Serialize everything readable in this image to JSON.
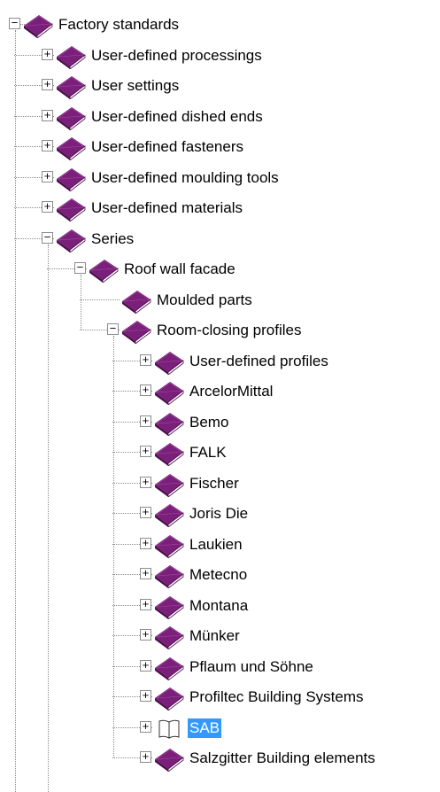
{
  "tree": {
    "selected_label": "SAB",
    "colors": {
      "book": "#7a1f7a",
      "book_dark": "#4a0f4a",
      "selection": "#3399ff"
    },
    "nodes": [
      {
        "label": "Factory standards",
        "level": 0,
        "expander": "−",
        "icon": "book-icon"
      },
      {
        "label": "User-defined processings",
        "level": 1,
        "expander": "+",
        "icon": "book-icon"
      },
      {
        "label": "User settings",
        "level": 1,
        "expander": "+",
        "icon": "book-icon"
      },
      {
        "label": "User-defined dished ends",
        "level": 1,
        "expander": "+",
        "icon": "book-icon"
      },
      {
        "label": "User-defined fasteners",
        "level": 1,
        "expander": "+",
        "icon": "book-icon"
      },
      {
        "label": "User-defined moulding tools",
        "level": 1,
        "expander": "+",
        "icon": "book-icon"
      },
      {
        "label": "User-defined materials",
        "level": 1,
        "expander": "+",
        "icon": "book-icon"
      },
      {
        "label": "Series",
        "level": 1,
        "expander": "−",
        "icon": "book-icon"
      },
      {
        "label": "Roof wall facade",
        "level": 2,
        "expander": "−",
        "icon": "book-icon"
      },
      {
        "label": "Moulded parts",
        "level": 3,
        "expander": "",
        "icon": "book-icon"
      },
      {
        "label": "Room-closing profiles",
        "level": 3,
        "expander": "−",
        "icon": "book-icon"
      },
      {
        "label": "User-defined profiles",
        "level": 4,
        "expander": "+",
        "icon": "book-icon"
      },
      {
        "label": "ArcelorMittal",
        "level": 4,
        "expander": "+",
        "icon": "book-icon"
      },
      {
        "label": "Bemo",
        "level": 4,
        "expander": "+",
        "icon": "book-icon"
      },
      {
        "label": "FALK",
        "level": 4,
        "expander": "+",
        "icon": "book-icon"
      },
      {
        "label": "Fischer",
        "level": 4,
        "expander": "+",
        "icon": "book-icon"
      },
      {
        "label": "Joris Die",
        "level": 4,
        "expander": "+",
        "icon": "book-icon"
      },
      {
        "label": "Laukien",
        "level": 4,
        "expander": "+",
        "icon": "book-icon"
      },
      {
        "label": "Metecno",
        "level": 4,
        "expander": "+",
        "icon": "book-icon"
      },
      {
        "label": "Montana",
        "level": 4,
        "expander": "+",
        "icon": "book-icon"
      },
      {
        "label": "Münker",
        "level": 4,
        "expander": "+",
        "icon": "book-icon"
      },
      {
        "label": "Pflaum und Söhne",
        "level": 4,
        "expander": "+",
        "icon": "book-icon"
      },
      {
        "label": "Profiltec Building Systems",
        "level": 4,
        "expander": "+",
        "icon": "book-icon"
      },
      {
        "label": "SAB",
        "level": 4,
        "expander": "+",
        "icon": "open-book-icon",
        "selected": true
      },
      {
        "label": "Salzgitter Building elements",
        "level": 4,
        "expander": "+",
        "icon": "book-icon"
      }
    ]
  }
}
